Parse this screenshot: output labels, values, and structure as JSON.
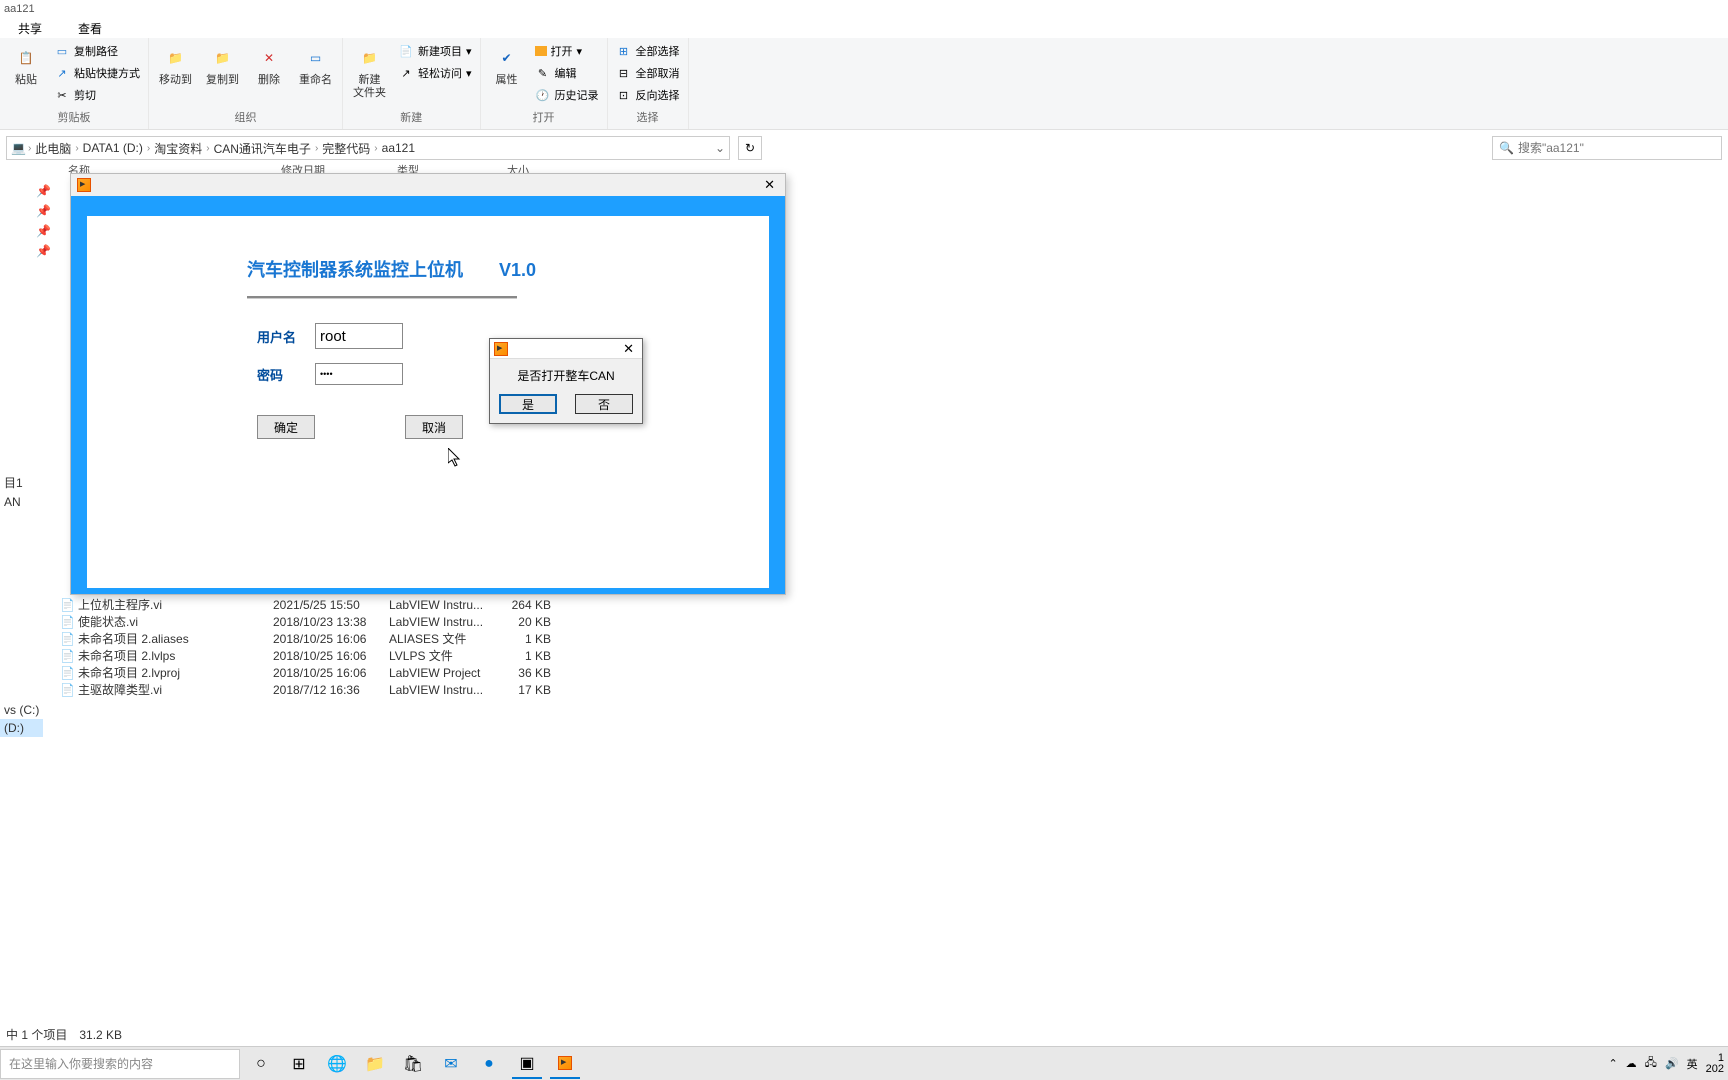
{
  "window_title": "aa121",
  "tabs": {
    "share": "共享",
    "view": "查看"
  },
  "ribbon": {
    "clipboard": {
      "label": "剪贴板",
      "paste": "粘贴",
      "copy_path": "复制路径",
      "paste_shortcut": "粘贴快捷方式",
      "cut": "剪切"
    },
    "organize": {
      "label": "组织",
      "moveto": "移动到",
      "copyto": "复制到",
      "delete": "删除",
      "rename": "重命名"
    },
    "new": {
      "label": "新建",
      "newfolder": "新建\n文件夹",
      "newitem": "新建项目",
      "easyaccess": "轻松访问"
    },
    "open": {
      "label": "打开",
      "properties": "属性",
      "open": "打开",
      "edit": "编辑",
      "history": "历史记录"
    },
    "select": {
      "label": "选择",
      "selectall": "全部选择",
      "selectnone": "全部取消",
      "invert": "反向选择"
    }
  },
  "breadcrumb": [
    "此电脑",
    "DATA1 (D:)",
    "淘宝资料",
    "CAN通讯汽车电子",
    "完整代码",
    "aa121"
  ],
  "search_placeholder": "搜索\"aa121\"",
  "columns": {
    "name": "名称",
    "date": "修改日期",
    "type": "类型",
    "size": "大小"
  },
  "left_items": {
    "l1": "目1",
    "l2": "AN",
    "l3": "vs (C:)",
    "l4": "(D:)"
  },
  "files": [
    {
      "name": "上位机主程序.vi",
      "date": "2021/5/25 15:50",
      "type": "LabVIEW Instru...",
      "size": "264 KB"
    },
    {
      "name": "使能状态.vi",
      "date": "2018/10/23 13:38",
      "type": "LabVIEW Instru...",
      "size": "20 KB"
    },
    {
      "name": "未命名项目 2.aliases",
      "date": "2018/10/25 16:06",
      "type": "ALIASES 文件",
      "size": "1 KB"
    },
    {
      "name": "未命名项目 2.lvlps",
      "date": "2018/10/25 16:06",
      "type": "LVLPS 文件",
      "size": "1 KB"
    },
    {
      "name": "未命名项目 2.lvproj",
      "date": "2018/10/25 16:06",
      "type": "LabVIEW Project",
      "size": "36 KB"
    },
    {
      "name": "主驱故障类型.vi",
      "date": "2018/7/12 16:36",
      "type": "LabVIEW Instru...",
      "size": "17 KB"
    }
  ],
  "login": {
    "title": "汽车控制器系统监控上位机　　V1.0",
    "username_label": "用户名",
    "password_label": "密码",
    "username_value": "root",
    "password_value": "••••",
    "ok": "确定",
    "cancel": "取消"
  },
  "dialog": {
    "message": "是否打开整车CAN",
    "yes": "是",
    "no": "否"
  },
  "statusbar": "中 1 个项目　31.2 KB",
  "taskbar_search": "在这里输入你要搜索的内容",
  "taskbar_lang": "英",
  "taskbar_time": "1\n202"
}
